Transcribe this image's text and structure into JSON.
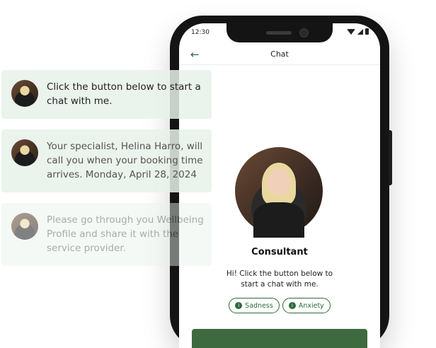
{
  "status": {
    "time": "12:30"
  },
  "header": {
    "title": "Chat"
  },
  "profile": {
    "name": "Consultant",
    "intro": "Hi! Click the button below to start a chat with me."
  },
  "tags": [
    "Sadness",
    "Anxiety"
  ],
  "cards": [
    {
      "text": "Click the button below to start a chat with me."
    },
    {
      "text": "Your specialist, Helina Harro, will call you when your booking time arrives. Monday, April 28, 2024"
    },
    {
      "text": "Please go through you Wellbeing Profile and share it with the service provider."
    }
  ],
  "colors": {
    "accent": "#2e6b3a",
    "button": "#3d6b3f",
    "card_bg": "#e8f1ea"
  }
}
